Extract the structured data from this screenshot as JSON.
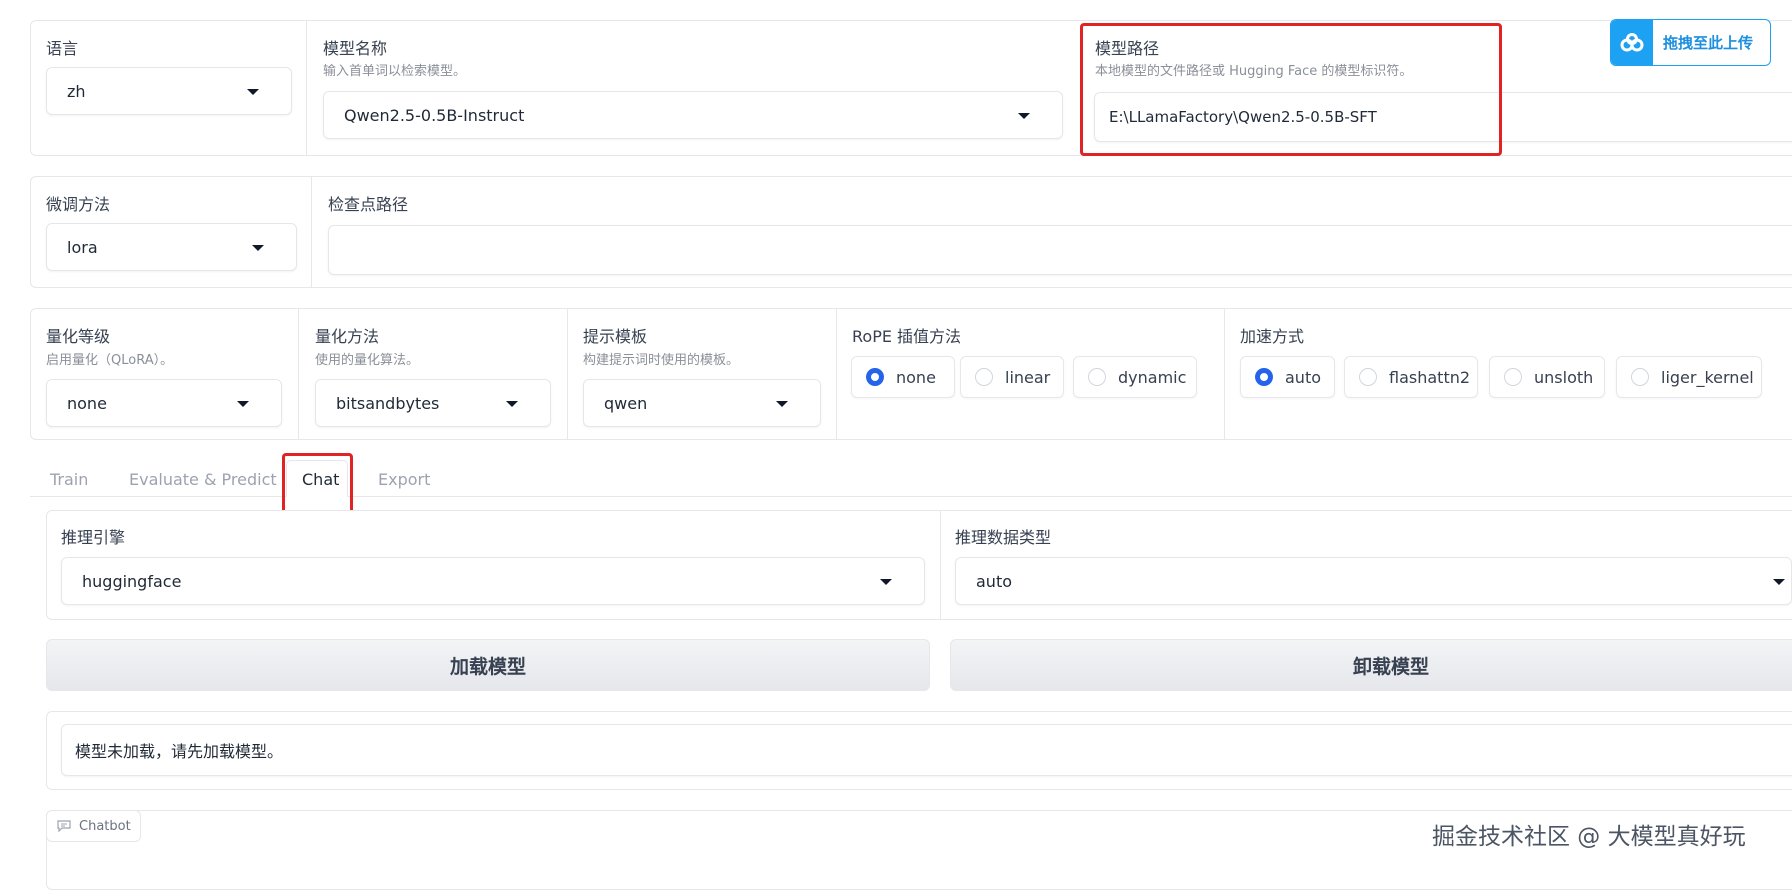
{
  "top": {
    "language": {
      "label": "语言",
      "value": "zh"
    },
    "model_name": {
      "label": "模型名称",
      "hint": "输入首单词以检索模型。",
      "value": "Qwen2.5-0.5B-Instruct"
    },
    "model_path": {
      "label": "模型路径",
      "hint": "本地模型的文件路径或 Hugging Face 的模型标识符。",
      "value": "E:\\LLamaFactory\\Qwen2.5-0.5B-SFT"
    },
    "upload_badge": {
      "label": "拖拽至此上传"
    }
  },
  "finetune": {
    "method": {
      "label": "微调方法",
      "value": "lora"
    },
    "checkpoint": {
      "label": "检查点路径",
      "value": ""
    }
  },
  "quant": {
    "level": {
      "label": "量化等级",
      "hint": "启用量化（QLoRA）。",
      "value": "none"
    },
    "method": {
      "label": "量化方法",
      "hint": "使用的量化算法。",
      "value": "bitsandbytes"
    },
    "template": {
      "label": "提示模板",
      "hint": "构建提示词时使用的模板。",
      "value": "qwen"
    },
    "rope": {
      "label": "RoPE 插值方法",
      "options": [
        "none",
        "linear",
        "dynamic"
      ],
      "selected": "none"
    },
    "accel": {
      "label": "加速方式",
      "options": [
        "auto",
        "flashattn2",
        "unsloth",
        "liger_kernel"
      ],
      "selected": "auto"
    }
  },
  "tabs": [
    "Train",
    "Evaluate & Predict",
    "Chat",
    "Export"
  ],
  "active_tab": "Chat",
  "chat": {
    "engine": {
      "label": "推理引擎",
      "value": "huggingface"
    },
    "dtype": {
      "label": "推理数据类型",
      "value": "auto"
    },
    "load_button": "加载模型",
    "unload_button": "卸载模型",
    "status": "模型未加载，请先加载模型。",
    "chatbot_label": "Chatbot"
  },
  "watermark": "掘金技术社区 @ 大模型真好玩",
  "colors": {
    "highlight": "#e02424",
    "accent": "#2563eb",
    "badge": "#1da1f2"
  }
}
